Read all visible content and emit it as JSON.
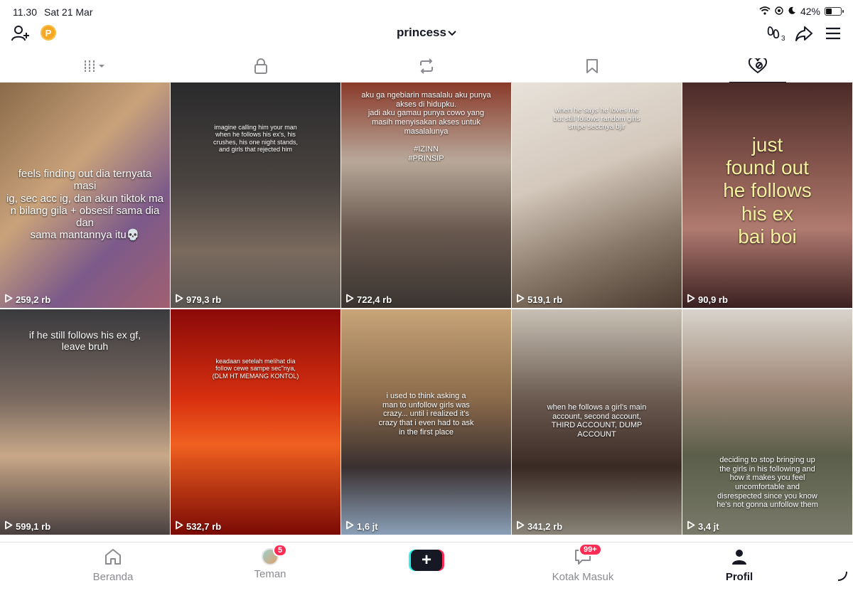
{
  "status": {
    "time": "11.30",
    "date": "Sat 21 Mar",
    "battery": "42%",
    "battery_level": 0.42
  },
  "header": {
    "username": "princess"
  },
  "tabs": [
    {
      "icon": "grid-icon",
      "active": false
    },
    {
      "icon": "lock-icon",
      "active": false
    },
    {
      "icon": "repost-icon",
      "active": false
    },
    {
      "icon": "bookmark-icon",
      "active": false
    },
    {
      "icon": "liked-heart-icon",
      "active": true
    }
  ],
  "videos": [
    {
      "caption": "feels finding out dia ternyata masi\nig, sec acc ig, dan akun tiktok ma\nn bilang gila + obsesif sama dia dan\nsama mantannya itu💀",
      "views": "259,2 rb",
      "bg": "linear-gradient(135deg,#8a6a4a 0%,#c9a27a 40%,#7c5a8a 70%,#a06070 100%)"
    },
    {
      "caption": "imagine calling him your man\nwhen he follows his ex's, his\ncrushes, his one night stands,\nand girls that rejected him",
      "views": "979,3 rb",
      "bg": "linear-gradient(180deg,#2a2a2c 0%,#4a4440 45%,#7a6a5e 75%,#5a5550 100%)"
    },
    {
      "caption": "aku ga ngebiarin masalalu aku punya\nakses di hidupku.\njadi aku gamau punya cowo yang\nmasih menyisakan akses untuk\nmasalalunya\n\n#IZINN\n#PRINSIP",
      "views": "722,4 rb",
      "bg": "linear-gradient(180deg,#8a3a2a 0%,#b8a89a 35%,#6a5a50 65%,#3a3430 100%)"
    },
    {
      "caption": "when he says he loves me\nbut still follows random girls\nsmpe seccnya bjir",
      "views": "519,1 rb",
      "bg": "linear-gradient(160deg,#e8e2da 0%,#d4c8bc 40%,#8a7a6a 70%,#4a3a30 100%)"
    },
    {
      "caption": "just\nfound out\nhe follows\nhis ex\nbai boi",
      "views": "90,9 rb",
      "bg": "linear-gradient(180deg,#4a2a28 0%,#8a5a50 40%,#b07a70 65%,#3a2020 100%)"
    },
    {
      "caption": "if he still follows his ex gf,\nleave bruh",
      "views": "599,1 rb",
      "bg": "linear-gradient(180deg,#3a3a3e 0%,#7a6a60 40%,#c8a888 65%,#4a4040 100%)"
    },
    {
      "caption": "keadaan setelah melihat dia\nfollow cewe sampe sec\"nya,\n(DLM HT MEMANG KONTOL)",
      "views": "532,7 rb",
      "bg": "linear-gradient(180deg,#8a0a08 0%,#d83010 40%,#f06020 60%,#7a0a05 100%)"
    },
    {
      "caption": "i used to think asking a\nman to unfollow girls was\ncrazy... until i realized it's\ncrazy that i even had to ask\nin the first place",
      "views": "1,6 jt",
      "bg": "linear-gradient(180deg,#c8a478 0%,#8a6a4a 40%,#3a3030 70%,#8aa0b8 100%)"
    },
    {
      "caption": "when he follows a girl's main\naccount, second account,\nTHIRD ACCOUNT, DUMP\nACCOUNT",
      "views": "341,2 rb",
      "bg": "linear-gradient(180deg,#c8c0b4 0%,#6a5a50 40%,#3a2a24 70%,#8a8478 100%)"
    },
    {
      "caption": "deciding to stop bringing up\nthe girls in his following and\nhow it makes you feel\nuncomfortable and\ndisrespected since you know\nhe's not gonna unfollow them",
      "views": "3,4 jt",
      "bg": "linear-gradient(180deg,#d8d4cc 0%,#a08878 35%,#5a5e4a 65%,#7a7a6a 100%)"
    }
  ],
  "bottom_nav": {
    "home": "Beranda",
    "friends": "Teman",
    "friends_badge": "5",
    "inbox": "Kotak Masuk",
    "inbox_badge": "99+",
    "profile": "Profil"
  }
}
